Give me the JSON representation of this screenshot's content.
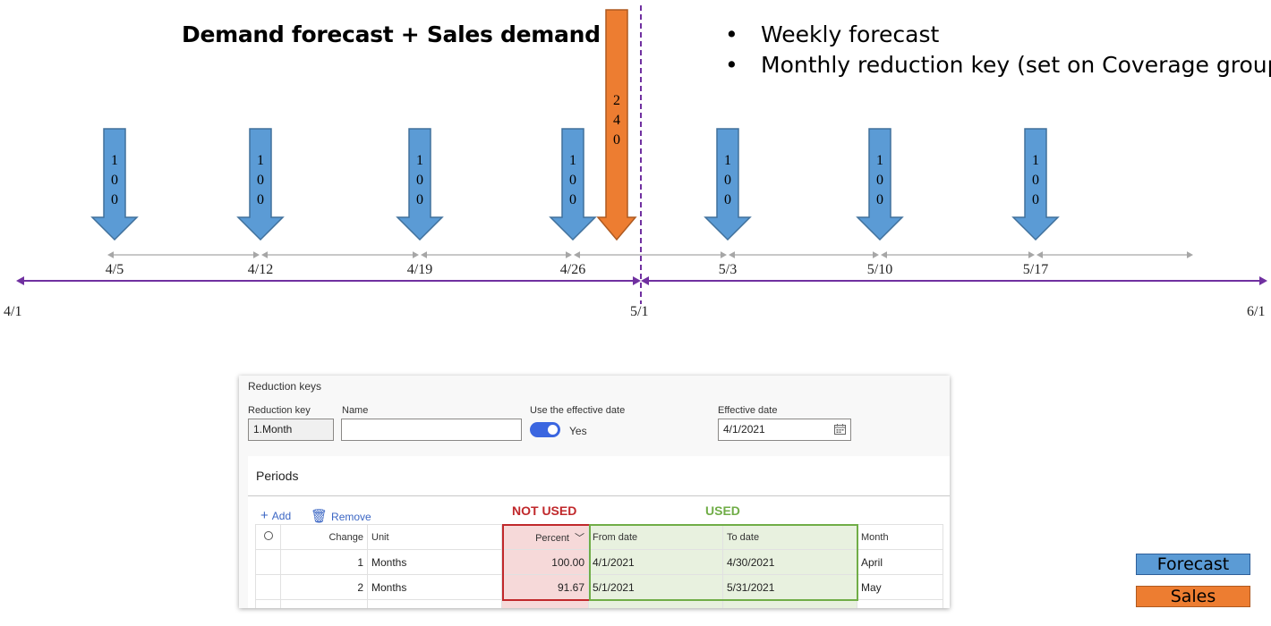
{
  "diagram": {
    "title": "Demand forecast + Sales demand",
    "bullets": [
      "Weekly forecast",
      "Monthly reduction key (set on Coverage group)"
    ],
    "colors": {
      "forecast": "#5b9bd5",
      "forecast_border": "#41719c",
      "sales": "#ed7d31",
      "sales_border": "#ae5a21",
      "timeline": "#7030a0",
      "week_axis": "#a6a6a6"
    },
    "month_start": "4/1",
    "month_mid": "5/1",
    "month_end": "6/1",
    "forecast_arrows": [
      {
        "date": "4/5",
        "value": "100"
      },
      {
        "date": "4/12",
        "value": "100"
      },
      {
        "date": "4/19",
        "value": "100"
      },
      {
        "date": "4/26",
        "value": "100"
      },
      {
        "date": "5/3",
        "value": "100"
      },
      {
        "date": "5/10",
        "value": "100"
      },
      {
        "date": "5/17",
        "value": "100"
      }
    ],
    "sales_arrow": {
      "value": "240"
    }
  },
  "panel": {
    "title": "Reduction keys",
    "fields": {
      "reduction_key_label": "Reduction key",
      "reduction_key_value": "1.Month",
      "name_label": "Name",
      "name_value": "",
      "effective_toggle_label": "Use the effective date",
      "effective_toggle_value": "Yes",
      "effective_date_label": "Effective date",
      "effective_date_value": "4/1/2021"
    },
    "periods": {
      "title": "Periods",
      "add_label": "Add",
      "remove_label": "Remove",
      "annotation_not_used": "NOT USED",
      "annotation_used": "USED",
      "columns": [
        "Change",
        "Unit",
        "Percent",
        "From date",
        "To date",
        "Month"
      ],
      "rows": [
        {
          "change": "1",
          "unit": "Months",
          "percent": "100.00",
          "from": "4/1/2021",
          "to": "4/30/2021",
          "month": "April"
        },
        {
          "change": "2",
          "unit": "Months",
          "percent": "91.67",
          "from": "5/1/2021",
          "to": "5/31/2021",
          "month": "May"
        }
      ]
    }
  },
  "legend": {
    "forecast": "Forecast",
    "sales": "Sales"
  }
}
